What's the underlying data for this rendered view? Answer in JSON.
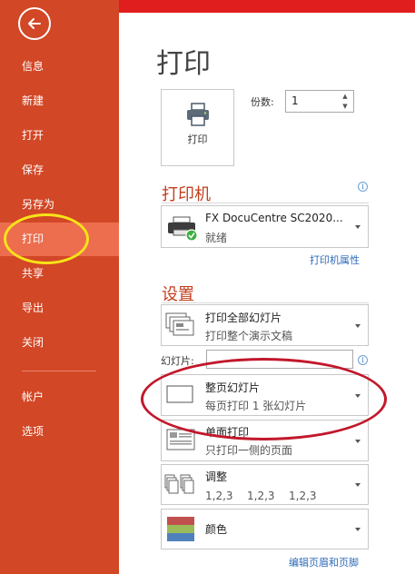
{
  "sidebar": {
    "back_icon": "arrow-left-circle-icon",
    "items": [
      {
        "label": "信息"
      },
      {
        "label": "新建"
      },
      {
        "label": "打开"
      },
      {
        "label": "保存"
      },
      {
        "label": "另存为"
      },
      {
        "label": "打印",
        "active": true
      },
      {
        "label": "共享"
      },
      {
        "label": "导出"
      },
      {
        "label": "关闭"
      },
      {
        "label": "帐户"
      },
      {
        "label": "选项"
      }
    ]
  },
  "page": {
    "title": "打印"
  },
  "print_button": {
    "label": "打印",
    "icon": "printer-icon"
  },
  "copies": {
    "label": "份数:",
    "value": "1"
  },
  "printer": {
    "section_title": "打印机",
    "name": "FX DocuCentre SC2020...",
    "status": "就绪",
    "properties_link": "打印机属性"
  },
  "settings": {
    "section_title": "设置",
    "range": {
      "main": "打印全部幻灯片",
      "sub": "打印整个演示文稿"
    },
    "slides_label": "幻灯片:",
    "slides_value": "",
    "layout": {
      "main": "整页幻灯片",
      "sub": "每页打印 1 张幻灯片"
    },
    "sides": {
      "main": "单面打印",
      "sub": "只打印一侧的页面"
    },
    "collate": {
      "main": "调整",
      "cols": [
        "1,2,3",
        "1,2,3",
        "1,2,3"
      ]
    },
    "color": {
      "main": "颜色"
    },
    "header_footer_link": "编辑页眉和页脚"
  },
  "colors": {
    "rail": "#d24726",
    "rail_active": "#ec6e4e",
    "top_strip": "#e01e1e",
    "section_title": "#c43e1c",
    "link": "#2e6bb8",
    "annotation_yellow": "#f7e319",
    "annotation_red": "#c2182b"
  }
}
